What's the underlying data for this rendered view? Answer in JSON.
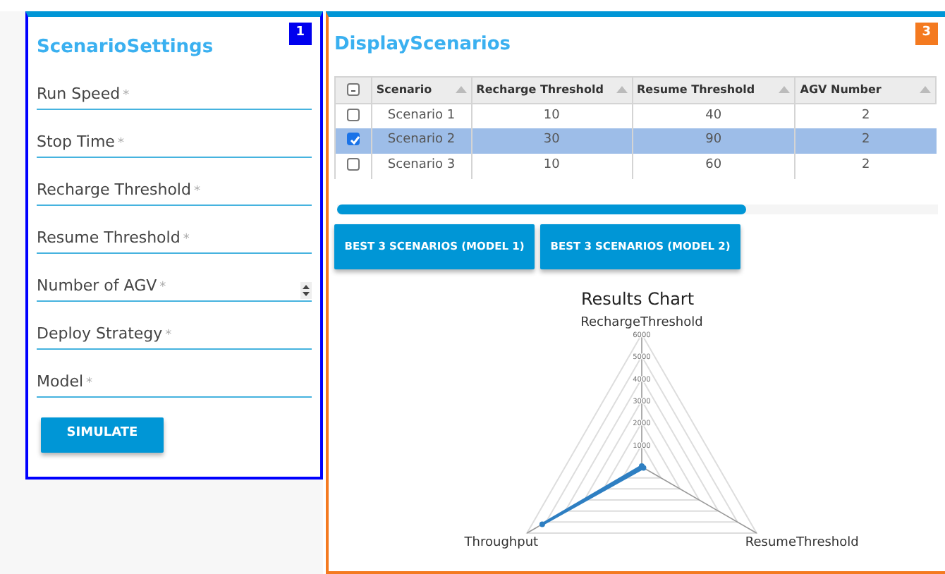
{
  "settings": {
    "title": "ScenarioSettings",
    "badge": "1",
    "fields": [
      {
        "label": "Run Speed",
        "mark": "*",
        "kind": "text"
      },
      {
        "label": "Stop Time",
        "mark": "*",
        "kind": "text"
      },
      {
        "label": "Recharge Threshold",
        "mark": "*",
        "kind": "text"
      },
      {
        "label": "Resume Threshold",
        "mark": "*",
        "kind": "text"
      },
      {
        "label": "Number of AGV",
        "mark": "*",
        "kind": "number"
      },
      {
        "label": "Deploy Strategy",
        "mark": "*",
        "kind": "text"
      },
      {
        "label": "Model",
        "mark": "*",
        "kind": "text"
      }
    ],
    "button": "SIMULATE"
  },
  "scenarios": {
    "title": "DisplayScenarios",
    "badge": "3",
    "select_all": {
      "indeterminate": true
    },
    "table": {
      "columns": [
        "Scenario",
        "Recharge Threshold",
        "Resume Threshold",
        "AGV Number"
      ],
      "rows": [
        {
          "cells": [
            "Scenario 1",
            "10",
            "40",
            "2"
          ],
          "selected": false
        },
        {
          "cells": [
            "Scenario 2",
            "30",
            "90",
            "2"
          ],
          "selected": true
        },
        {
          "cells": [
            "Scenario 3",
            "10",
            "60",
            "2"
          ],
          "selected": false
        }
      ]
    },
    "buttons": [
      "BEST 3 SCENARIOS (MODEL 1)",
      "BEST 3 SCENARIOS (MODEL 2)"
    ],
    "chart_data": {
      "type": "radar",
      "title": "Results Chart",
      "categories": [
        "RechargeThreshold",
        "ResumeThreshold",
        "Throughput"
      ],
      "ylim": [
        0,
        6000
      ],
      "yticks": [
        1000,
        2000,
        3000,
        4000,
        5000,
        6000
      ],
      "series": [
        {
          "color": "#2e7fc2",
          "values": [
            30,
            90,
            5200
          ]
        }
      ]
    }
  }
}
